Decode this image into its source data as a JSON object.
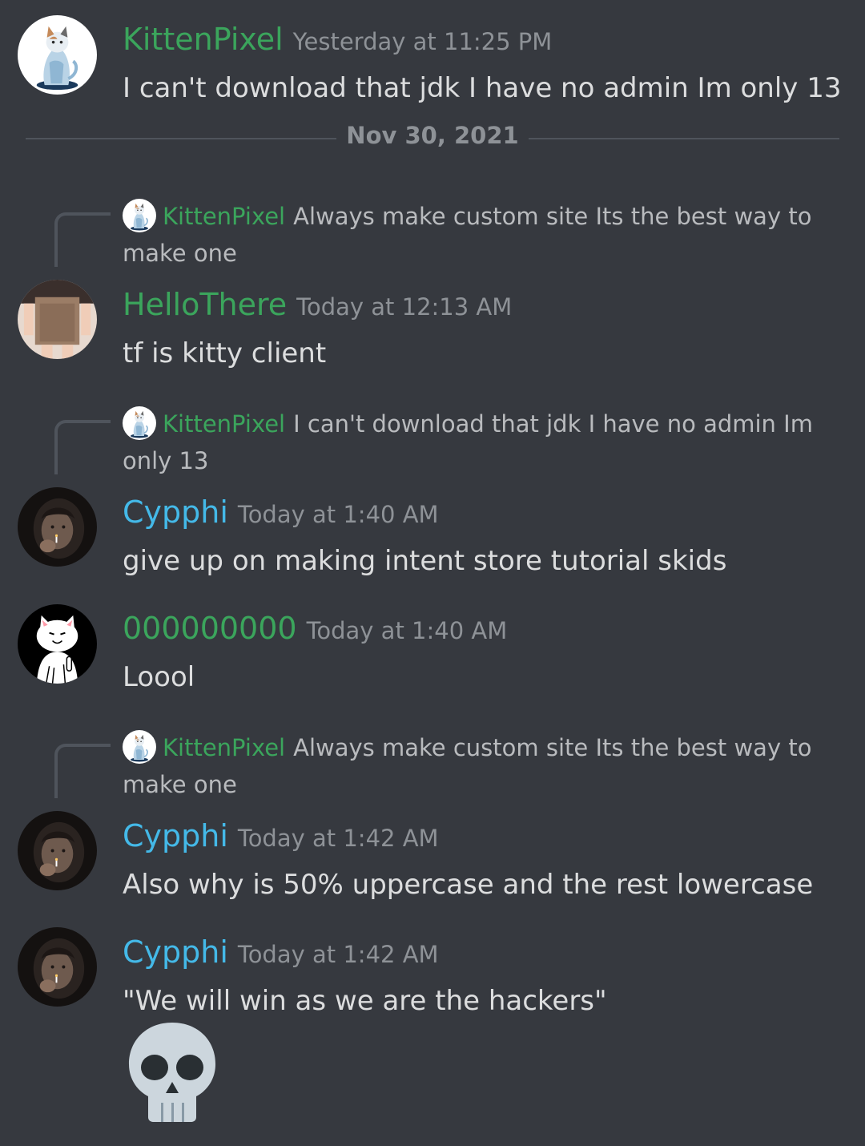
{
  "colors": {
    "background": "#36393f",
    "green_name": "#3ba55c",
    "blue_name": "#44b9e8",
    "timestamp": "#8e9297",
    "text": "#dcddde"
  },
  "date_divider": "Nov 30, 2021",
  "messages": [
    {
      "author": "KittenPixel",
      "author_color": "green",
      "timestamp": "Yesterday at 11:25 PM",
      "text": "I can't download that jdk I have no admin Im only 13",
      "avatar": "cat-avatar"
    },
    {
      "reply_to": {
        "author": "KittenPixel",
        "text": "Always make custom site Its the best way to make one"
      },
      "author": "HelloThere",
      "author_color": "green",
      "timestamp": "Today at 12:13 AM",
      "text": "tf is kitty client",
      "avatar": "photo-avatar"
    },
    {
      "reply_to": {
        "author": "KittenPixel",
        "text": "I can't download that jdk I have no admin Im only 13"
      },
      "author": "Cypphi",
      "author_color": "blue",
      "timestamp": "Today at 1:40 AM",
      "text": "give up on making intent store tutorial skids",
      "avatar": "dark-photo-avatar"
    },
    {
      "author": "000000000",
      "author_color": "green",
      "timestamp": "Today at 1:40 AM",
      "text": "Loool",
      "avatar": "ripndip-cat-avatar"
    },
    {
      "reply_to": {
        "author": "KittenPixel",
        "text": "Always make custom site Its the best way to make one"
      },
      "author": "Cypphi",
      "author_color": "blue",
      "timestamp": "Today at 1:42 AM",
      "text": "Also why is 50% uppercase and the rest lowercase",
      "avatar": "dark-photo-avatar"
    },
    {
      "author": "Cypphi",
      "author_color": "blue",
      "timestamp": "Today at 1:42 AM",
      "text": "\"We will win as we are the hackers\"",
      "avatar": "dark-photo-avatar",
      "emoji": "skull-emoji"
    }
  ]
}
